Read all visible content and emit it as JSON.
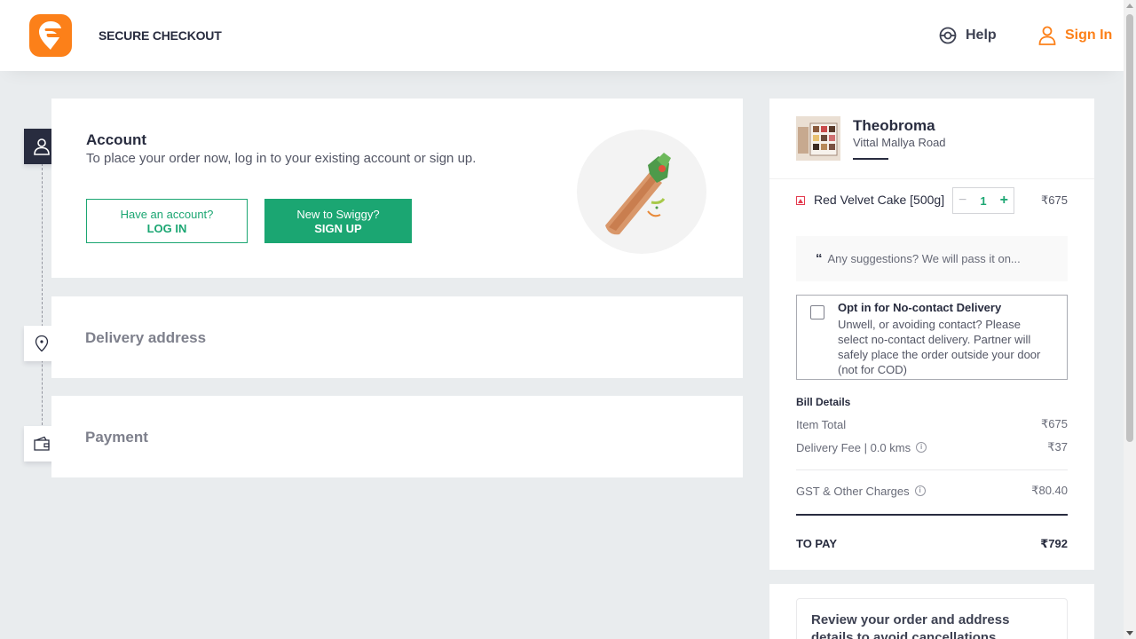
{
  "header": {
    "title": "SECURE CHECKOUT",
    "help_label": "Help",
    "signin_label": "Sign In",
    "brand_color": "#fc8019"
  },
  "steps": {
    "account": {
      "title": "Account",
      "subtitle": "To place your order now, log in to your existing account or sign up.",
      "login_small": "Have an account?",
      "login_big": "LOG IN",
      "signup_small": "New to Swiggy?",
      "signup_big": "SIGN UP"
    },
    "address": {
      "title": "Delivery address"
    },
    "payment": {
      "title": "Payment"
    }
  },
  "cart": {
    "restaurant": {
      "name": "Theobroma",
      "area": "Vittal Mallya Road"
    },
    "items": [
      {
        "name": "Red Velvet Cake [500g]",
        "qty": "1",
        "price": "₹675",
        "minus": "−",
        "plus": "+"
      }
    ],
    "suggestion_placeholder": "Any suggestions? We will pass it on...",
    "no_contact": {
      "title": "Opt in for No-contact Delivery",
      "description": "Unwell, or avoiding contact? Please select no-contact delivery. Partner will safely place the order outside your door (not for COD)"
    },
    "bill": {
      "title": "Bill Details",
      "item_total_label": "Item Total",
      "item_total_value": "₹675",
      "delivery_label": "Delivery Fee | 0.0 kms",
      "delivery_value": "₹37",
      "gst_label": "GST & Other Charges",
      "gst_value": "₹80.40",
      "to_pay_label": "TO PAY",
      "to_pay_value": "₹792"
    }
  },
  "review": {
    "text": "Review your order and address details to avoid cancellations"
  },
  "colors": {
    "accent_green": "#1ba672",
    "dark": "#282c3f"
  }
}
